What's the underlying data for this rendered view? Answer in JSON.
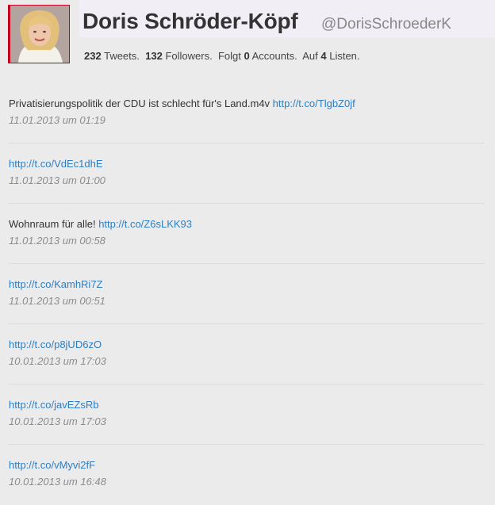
{
  "profile": {
    "name": "Doris Schröder-Köpf",
    "handle": "@DorisSchroederK",
    "stats": {
      "tweets_count": "232",
      "tweets_label": "Tweets.",
      "followers_count": "132",
      "followers_label": "Followers.",
      "follows_prefix": "Folgt",
      "follows_count": "0",
      "follows_label": "Accounts.",
      "lists_prefix": "Auf",
      "lists_count": "4",
      "lists_label": "Listen."
    },
    "colors": {
      "accent_border": "#c3001f",
      "link": "#2f7ec1"
    }
  },
  "tweets": [
    {
      "text": "Privatisierungspolitik der CDU ist schlecht für's Land.m4v ",
      "link": "http://t.co/TlgbZ0jf",
      "time": "11.01.2013 um 01:19"
    },
    {
      "text": "",
      "link": "http://t.co/VdEc1dhE",
      "time": "11.01.2013 um 01:00"
    },
    {
      "text": "Wohnraum für alle! ",
      "link": "http://t.co/Z6sLKK93",
      "time": "11.01.2013 um 00:58"
    },
    {
      "text": "",
      "link": "http://t.co/KamhRi7Z",
      "time": "11.01.2013 um 00:51"
    },
    {
      "text": "",
      "link": "http://t.co/p8jUD6zO",
      "time": "10.01.2013 um 17:03"
    },
    {
      "text": "",
      "link": "http://t.co/javEZsRb",
      "time": "10.01.2013 um 17:03"
    },
    {
      "text": "",
      "link": "http://t.co/vMyvi2fF",
      "time": "10.01.2013 um 16:48"
    }
  ]
}
